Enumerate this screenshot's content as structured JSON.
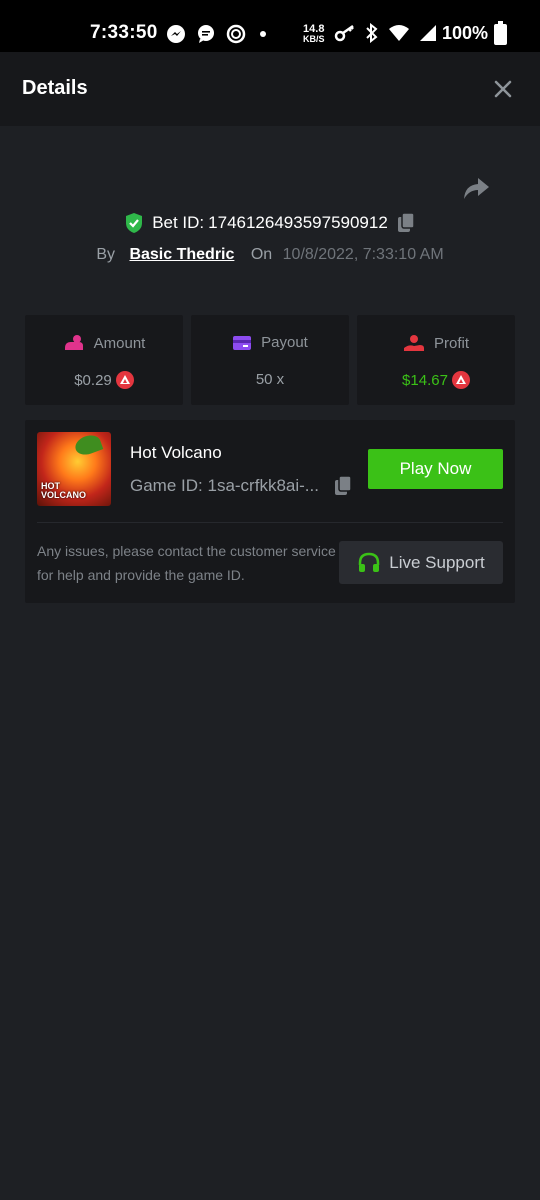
{
  "status_bar": {
    "time": "7:33:50",
    "net_speed_value": "14.8",
    "net_speed_unit": "KB/S",
    "battery": "100%"
  },
  "header": {
    "title": "Details"
  },
  "bet": {
    "id_label": "Bet ID:",
    "id_value": "1746126493597590912",
    "by_label": "By",
    "user": "Basic Thedric",
    "on_label": "On",
    "date": "10/8/2022, 7:33:10 AM"
  },
  "stats": {
    "amount": {
      "label": "Amount",
      "value": "$0.29"
    },
    "payout": {
      "label": "Payout",
      "value": "50 x"
    },
    "profit": {
      "label": "Profit",
      "value": "$14.67"
    }
  },
  "game": {
    "name": "Hot Volcano",
    "id_label": "Game ID:",
    "id_value": "1sa-crfkk8ai-...",
    "play_label": "Play Now",
    "thumb_text_line1": "HOT",
    "thumb_text_line2": "VOLCANO"
  },
  "support": {
    "help_text": "Any issues, please contact the customer service for help and provide the game ID.",
    "button_label": "Live Support"
  },
  "colors": {
    "accent_green": "#3bc117",
    "coin_red": "#e4363f",
    "shield_green": "#2fb84a"
  }
}
